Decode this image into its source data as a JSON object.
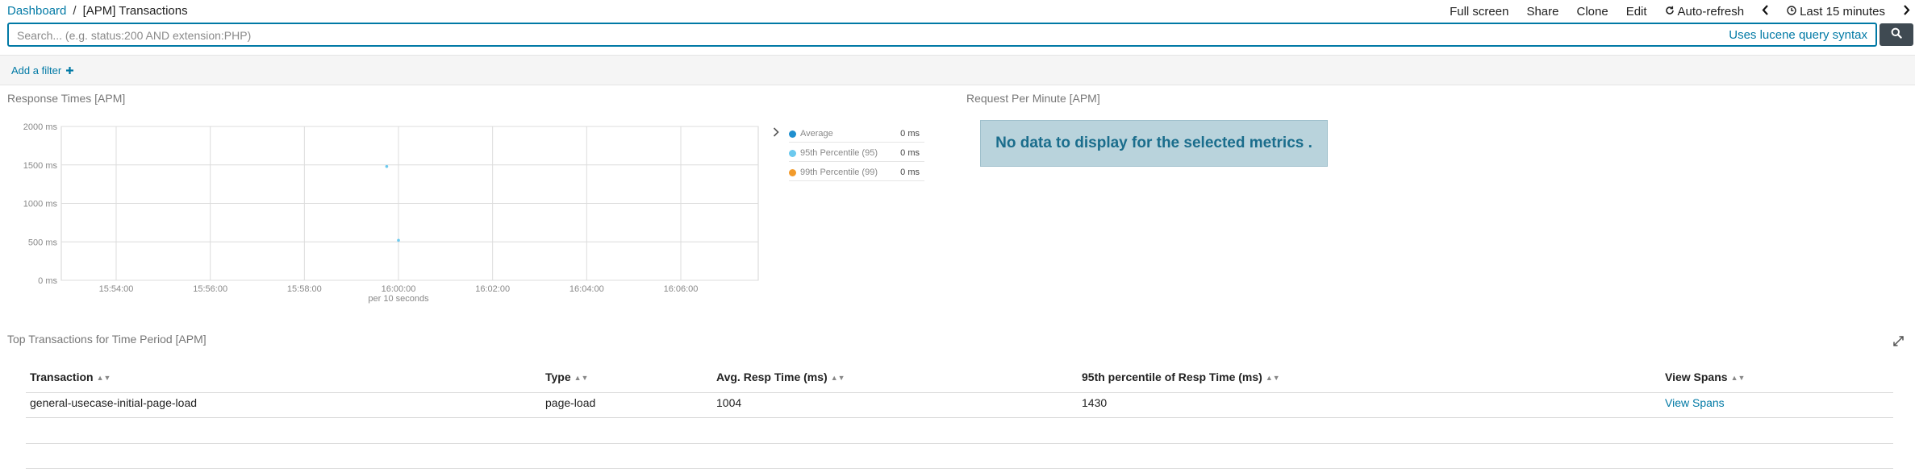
{
  "breadcrumb": {
    "root": "Dashboard",
    "separator": "/",
    "current": "[APM] Transactions"
  },
  "menu": {
    "full_screen": "Full screen",
    "share": "Share",
    "clone": "Clone",
    "edit": "Edit",
    "auto_refresh": "Auto-refresh",
    "time_range": "Last 15 minutes"
  },
  "search": {
    "placeholder": "Search... (e.g. status:200 AND extension:PHP)",
    "value": "",
    "syntax_link": "Uses lucene query syntax"
  },
  "filters": {
    "add_label": "Add a filter",
    "add_icon": "plus-icon"
  },
  "panels": {
    "response_times": {
      "title": "Response Times [APM]"
    },
    "requests_per_minute": {
      "title": "Request Per Minute [APM]",
      "message": "No data to display for the selected metrics ."
    },
    "top_transactions": {
      "title": "Top Transactions for Time Period [APM]"
    }
  },
  "chart_data": {
    "type": "line",
    "title": "",
    "xlabel": "per 10 seconds",
    "ylabel": "",
    "x_ticks": [
      "15:54:00",
      "15:56:00",
      "15:58:00",
      "16:00:00",
      "16:02:00",
      "16:04:00",
      "16:06:00"
    ],
    "y_ticks": [
      "2000 ms",
      "1500 ms",
      "1000 ms",
      "500 ms",
      "0 ms"
    ],
    "ylim": [
      0,
      2000
    ],
    "grid": true,
    "legend_placement": "right",
    "series": [
      {
        "name": "Average",
        "color": "#1f8fcf",
        "legend_value": "0 ms",
        "points": []
      },
      {
        "name": "95th Percentile (95)",
        "color": "#6cc9ee",
        "legend_value": "0 ms",
        "points": [
          {
            "x": "15:59:45",
            "y": 1480
          },
          {
            "x": "16:00:00",
            "y": 520
          }
        ]
      },
      {
        "name": "99th Percentile (99)",
        "color": "#f29b2c",
        "legend_value": "0 ms",
        "points": []
      }
    ]
  },
  "table": {
    "columns": [
      "Transaction",
      "Type",
      "Avg. Resp Time (ms)",
      "95th percentile of Resp Time (ms)",
      "View Spans"
    ],
    "rows": [
      {
        "transaction": "general-usecase-initial-page-load",
        "type": "page-load",
        "avg": "1004",
        "p95": "1430",
        "link": "View Spans"
      }
    ]
  },
  "colors": {
    "accent": "#0079a5",
    "nodata_bg": "#b9d3dc",
    "search_button": "#3f4a52"
  }
}
